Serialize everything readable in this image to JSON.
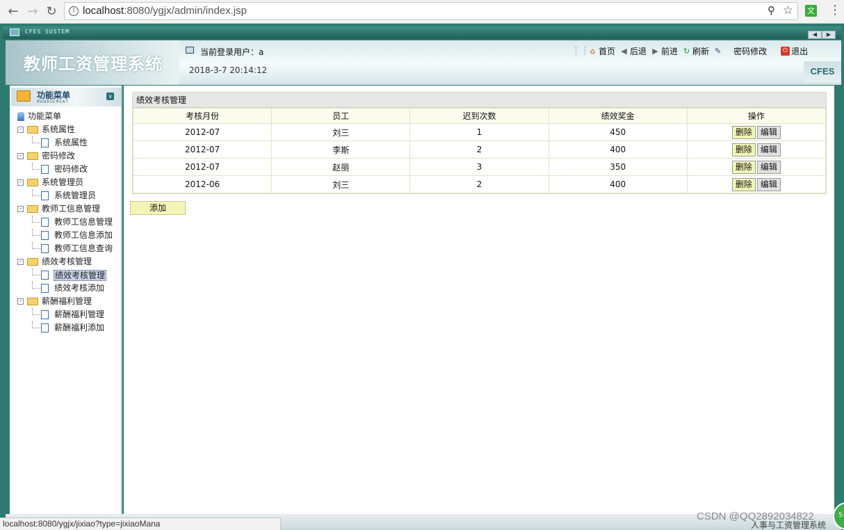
{
  "browser": {
    "url_host": "localhost",
    "url_rest": ":8080/ygjx/admin/index.jsp",
    "ext_label": "文",
    "status_url": "localhost:8080/ygjx/jixiao?type=jixiaoMana"
  },
  "app": {
    "system_name": "CFES SUSTEM",
    "title": "教师工资管理系统",
    "current_user_label": "当前登录用户：a",
    "datetime": "2018-3-7 20:14:12",
    "brand": "CFES",
    "toolbar": {
      "home": "首页",
      "back": "后退",
      "forward": "前进",
      "refresh": "刷新",
      "password": "密码修改",
      "logout": "退出"
    }
  },
  "sidebar": {
    "title": "功能菜单",
    "subtitle": "MANAGEMENT",
    "root": "功能菜单",
    "groups": [
      {
        "label": "系统属性",
        "items": [
          "系统属性"
        ]
      },
      {
        "label": "密码修改",
        "items": [
          "密码修改"
        ]
      },
      {
        "label": "系统管理员",
        "items": [
          "系统管理员"
        ]
      },
      {
        "label": "教师工信息管理",
        "items": [
          "教师工信息管理",
          "教师工信息添加",
          "教师工信息查询"
        ]
      },
      {
        "label": "绩效考核管理",
        "items": [
          "绩效考核管理",
          "绩效考核添加"
        ]
      },
      {
        "label": "薪酬福利管理",
        "items": [
          "薪酬福利管理",
          "薪酬福利添加"
        ]
      }
    ]
  },
  "main": {
    "panel_title": "绩效考核管理",
    "columns": [
      "考核月份",
      "员工",
      "迟到次数",
      "绩效奖金",
      "操作"
    ],
    "rows": [
      {
        "month": "2012-07",
        "employee": "刘三",
        "late": "1",
        "bonus": "450"
      },
      {
        "month": "2012-07",
        "employee": "李斯",
        "late": "2",
        "bonus": "400"
      },
      {
        "month": "2012-07",
        "employee": "赵丽",
        "late": "3",
        "bonus": "350"
      },
      {
        "month": "2012-06",
        "employee": "刘三",
        "late": "2",
        "bonus": "400"
      }
    ],
    "delete_label": "删除",
    "edit_label": "编辑",
    "add_label": "添加"
  },
  "footer": {
    "text": "人事与工资管理系统",
    "watermark": "CSDN @QQ2892034822"
  }
}
